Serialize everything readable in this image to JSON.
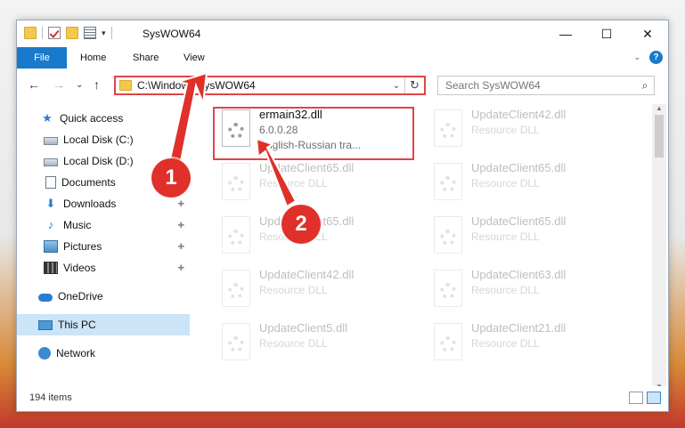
{
  "window": {
    "title": "SysWOW64",
    "minimize": "—",
    "maximize": "☐",
    "close": "✕"
  },
  "ribbon": {
    "tabs": [
      "File",
      "Home",
      "Share",
      "View"
    ],
    "expand": "⌄",
    "help": "?"
  },
  "nav": {
    "back": "←",
    "forward": "→",
    "recent": "⌄",
    "up": "↑",
    "address": "C:\\Windows\\SysWOW64",
    "address_dropdown": "⌄",
    "refresh": "↻",
    "search_placeholder": "Search SysWOW64",
    "search_icon": "search-icon"
  },
  "sidebar": {
    "items": [
      {
        "label": "Quick access",
        "icon": "star-icon",
        "pinned": false
      },
      {
        "label": "Local Disk (C:)",
        "icon": "disk-icon",
        "pinned": false
      },
      {
        "label": "Local Disk (D:)",
        "icon": "disk-icon",
        "pinned": false
      },
      {
        "label": "Documents",
        "icon": "document-icon",
        "pinned": false
      },
      {
        "label": "Downloads",
        "icon": "download-icon",
        "pinned": true
      },
      {
        "label": "Music",
        "icon": "music-icon",
        "pinned": true
      },
      {
        "label": "Pictures",
        "icon": "pictures-icon",
        "pinned": true
      },
      {
        "label": "Videos",
        "icon": "videos-icon",
        "pinned": true
      },
      {
        "label": "OneDrive",
        "icon": "cloud-icon",
        "pinned": false
      },
      {
        "label": "This PC",
        "icon": "computer-icon",
        "pinned": false,
        "selected": true
      },
      {
        "label": "Network",
        "icon": "network-icon",
        "pinned": false
      }
    ],
    "pin_glyph": "📌"
  },
  "files": [
    {
      "name": "ermain32.dll",
      "line2": "6.0.0.28",
      "line3": "English-Russian tra...",
      "highlighted": true
    },
    {
      "name": "UpdateClient42.dll",
      "line2": "Resource DLL"
    },
    {
      "name": "UpdateClient65.dll",
      "line2": "Resource DLL"
    },
    {
      "name": "UpdateClient65.dll",
      "line2": "Resource DLL"
    },
    {
      "name": "UpdateClient65.dll",
      "line2": "Resource DLL"
    },
    {
      "name": "UpdateClient65.dll",
      "line2": "Resource DLL"
    },
    {
      "name": "UpdateClient42.dll",
      "line2": "Resource DLL"
    },
    {
      "name": "UpdateClient63.dll",
      "line2": "Resource DLL"
    },
    {
      "name": "UpdateClient5.dll",
      "line2": "Resource DLL"
    },
    {
      "name": "UpdateClient21.dll",
      "line2": "Resource DLL"
    }
  ],
  "status": {
    "item_count": "194 items"
  },
  "annotations": {
    "step1": "1",
    "step2": "2",
    "color": "#e0302a"
  }
}
